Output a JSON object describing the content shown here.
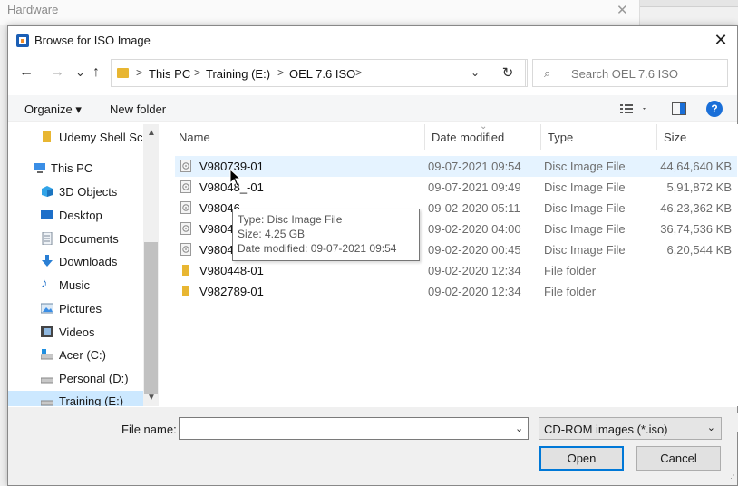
{
  "background_window": {
    "title": "Hardware"
  },
  "dialog": {
    "title": "Browse for ISO Image",
    "close_glyph": "✕"
  },
  "nav": {
    "back": "←",
    "forward": "→",
    "recent": "⌄",
    "up": "↑",
    "breadcrumbs": [
      "This PC",
      "Training (E:)",
      "OEL 7.6 ISO"
    ],
    "separator": ">",
    "refresh": "↻",
    "search_placeholder": "Search OEL 7.6 ISO"
  },
  "toolbar": {
    "organize": "Organize ▾",
    "new_folder": "New folder",
    "help": "?"
  },
  "sidebar": {
    "items": [
      {
        "label": "Udemy Shell Scri",
        "icon": "folder-icon"
      },
      {
        "label": "This PC",
        "icon": "this-pc-icon"
      },
      {
        "label": "3D Objects",
        "icon": "3d-objects-icon"
      },
      {
        "label": "Desktop",
        "icon": "desktop-icon"
      },
      {
        "label": "Documents",
        "icon": "documents-icon"
      },
      {
        "label": "Downloads",
        "icon": "downloads-icon"
      },
      {
        "label": "Music",
        "icon": "music-icon"
      },
      {
        "label": "Pictures",
        "icon": "pictures-icon"
      },
      {
        "label": "Videos",
        "icon": "videos-icon"
      },
      {
        "label": "Acer (C:)",
        "icon": "drive-c-icon"
      },
      {
        "label": "Personal (D:)",
        "icon": "drive-icon"
      },
      {
        "label": "Training (E:)",
        "icon": "drive-icon"
      }
    ]
  },
  "columns": {
    "name": "Name",
    "date_modified": "Date modified",
    "type": "Type",
    "size": "Size"
  },
  "files": [
    {
      "name": "V980739-01",
      "date": "09-07-2021 09:54",
      "type": "Disc Image File",
      "size": "44,64,640 KB",
      "kind": "disc"
    },
    {
      "name": "V98048_-01",
      "date": "09-07-2021 09:49",
      "type": "Disc Image File",
      "size": "5,91,872 KB",
      "kind": "disc"
    },
    {
      "name": "V98046",
      "date": "09-02-2020 05:11",
      "type": "Disc Image File",
      "size": "46,23,362 KB",
      "kind": "disc"
    },
    {
      "name": "V98046",
      "date": "09-02-2020 04:00",
      "type": "Disc Image File",
      "size": "36,74,536 KB",
      "kind": "disc"
    },
    {
      "name": "V980467-01",
      "date": "09-02-2020 00:45",
      "type": "Disc Image File",
      "size": "6,20,544 KB",
      "kind": "disc"
    },
    {
      "name": "V980448-01",
      "date": "09-02-2020 12:34",
      "type": "File folder",
      "size": "",
      "kind": "folder"
    },
    {
      "name": "V982789-01",
      "date": "09-02-2020 12:34",
      "type": "File folder",
      "size": "",
      "kind": "folder"
    }
  ],
  "tooltip": {
    "type_line": "Type: Disc Image File",
    "size_line": "Size: 4.25 GB",
    "date_line": "Date modified: 09-07-2021 09:54"
  },
  "footer": {
    "file_name_label": "File name:",
    "file_name_value": "",
    "filter_value": "CD-ROM images (*.iso)",
    "open_label": "Open",
    "cancel_label": "Cancel"
  },
  "colors": {
    "accent": "#0078d7",
    "folder": "#e8b632",
    "selected_nav": "#cce8ff",
    "hover_row": "#e5f3ff"
  }
}
